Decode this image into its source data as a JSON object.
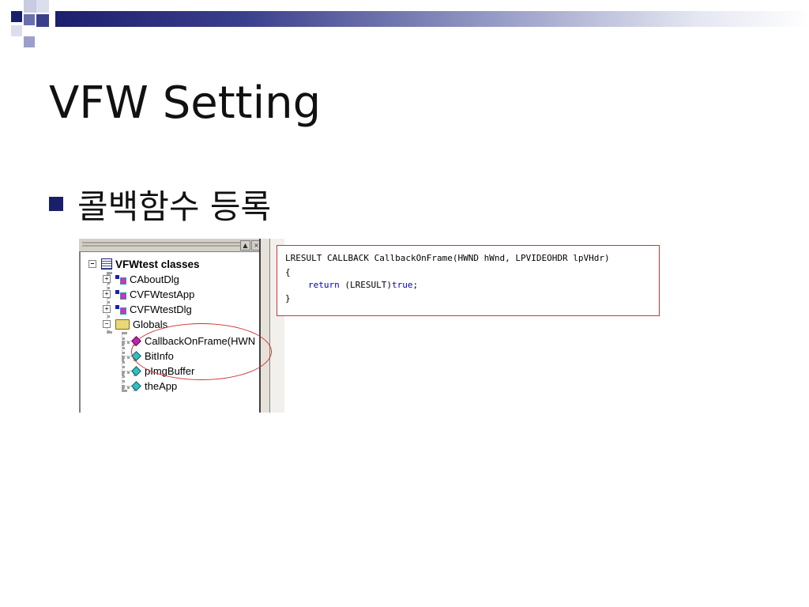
{
  "slide": {
    "title": "VFW Setting",
    "bullet": "콜백함수 등록",
    "accent_color": "#1a1f6b"
  },
  "class_view": {
    "window_buttons": [
      "▲",
      "×"
    ],
    "root": "VFWtest classes",
    "classes": [
      "CAboutDlg",
      "CVFWtestApp",
      "CVFWtestDlg"
    ],
    "globals_folder": "Globals",
    "globals": [
      "CallbackOnFrame(HWN",
      "BitInfo",
      "pImgBuffer",
      "theApp"
    ]
  },
  "code": {
    "line1": "LRESULT CALLBACK CallbackOnFrame(HWND hWnd, LPVIDEOHDR lpVHdr)",
    "line2": "{",
    "line3_return": "return",
    "line3_cast": " (LRESULT)",
    "line3_value": "true",
    "line3_end": ";",
    "line4": "}",
    "highlight_color": "#d83030",
    "keyword_color": "#0000c0"
  }
}
